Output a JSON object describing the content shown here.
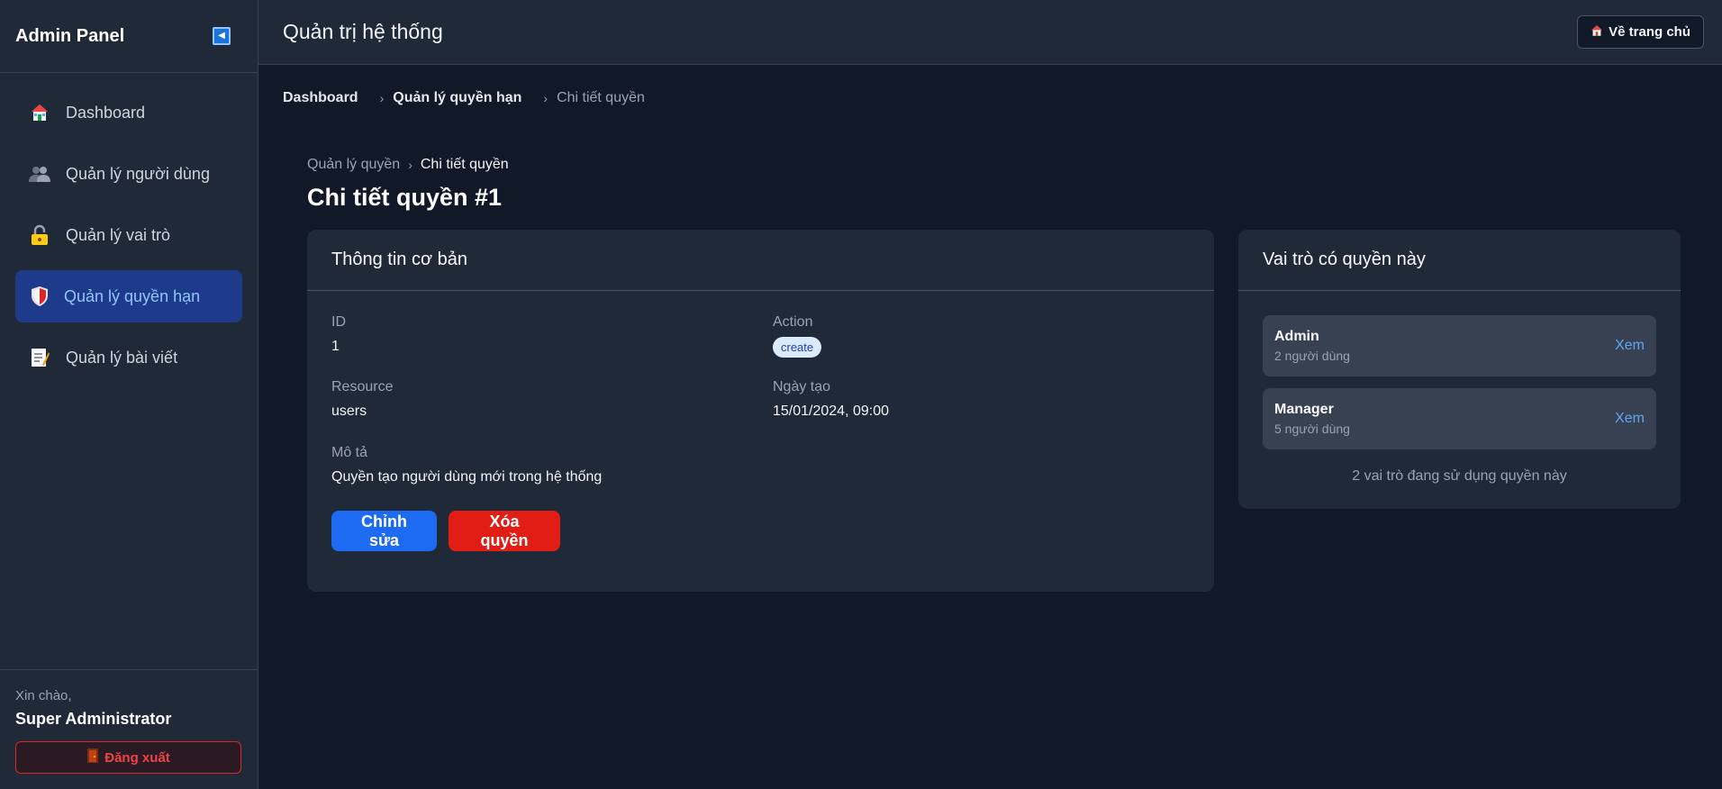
{
  "sidebar": {
    "brand": "Admin Panel",
    "collapse_icon": "◀",
    "items": [
      {
        "label": "Dashboard",
        "icon": "house-icon",
        "active": false
      },
      {
        "label": "Quản lý người dùng",
        "icon": "users-icon",
        "active": false
      },
      {
        "label": "Quản lý vai trò",
        "icon": "lock-icon",
        "active": false
      },
      {
        "label": "Quản lý quyền hạn",
        "icon": "shield-icon",
        "active": true
      },
      {
        "label": "Quản lý bài viết",
        "icon": "memo-icon",
        "active": false
      }
    ],
    "greeting": "Xin chào,",
    "username": "Super Administrator",
    "logout_label": "Đăng xuất"
  },
  "topbar": {
    "title": "Quản trị hệ thống",
    "home_label": "Về trang chủ"
  },
  "breadcrumb_top": [
    "Dashboard",
    "Quản lý quyền hạn",
    "Chi tiết quyền"
  ],
  "breadcrumb_inner": {
    "link": "Quản lý quyền",
    "current": "Chi tiết quyền"
  },
  "page_title": "Chi tiết quyền #1",
  "basic_info": {
    "header": "Thông tin cơ bản",
    "id_label": "ID",
    "id_value": "1",
    "action_label": "Action",
    "action_value": "create",
    "resource_label": "Resource",
    "resource_value": "users",
    "created_label": "Ngày tạo",
    "created_value": "15/01/2024, 09:00",
    "desc_label": "Mô tả",
    "desc_value": "Quyền tạo người dùng mới trong hệ thống",
    "edit_label": "Chỉnh sửa",
    "delete_label": "Xóa quyền"
  },
  "roles": {
    "header": "Vai trò có quyền này",
    "items": [
      {
        "name": "Admin",
        "count": "2 người dùng",
        "link": "Xem"
      },
      {
        "name": "Manager",
        "count": "5 người dùng",
        "link": "Xem"
      }
    ],
    "summary": "2 vai trò đang sử dụng quyền này"
  },
  "colors": {
    "accent": "#1d6bf3",
    "danger": "#e11d16",
    "active_nav_bg": "#1e3a8a",
    "link": "#60a5fa"
  }
}
